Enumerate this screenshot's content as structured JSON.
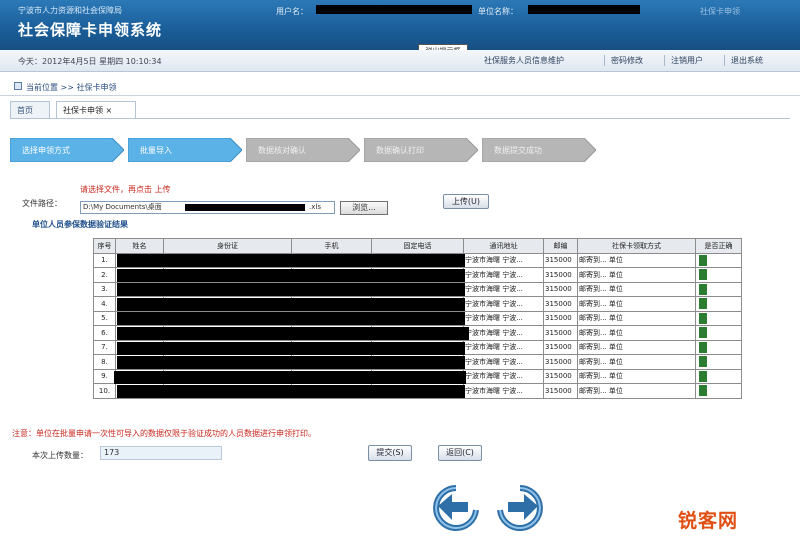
{
  "header": {
    "subtitle": "宁波市人力资源和社会保障局",
    "title": "社会保障卡申领系统",
    "user_label": "用户名：",
    "unit_label": "单位名称：",
    "right_text": "社保卡申领"
  },
  "infobar": {
    "date_text": "今天：2012年4月5日  星期四  10:10:34",
    "popup_tip": "弹出提示框",
    "nav": [
      "社保服务人员信息维护",
      "密码修改",
      "注销用户",
      "退出系统"
    ]
  },
  "location": {
    "prefix": "当前位置",
    "path": ">>  社保卡申领"
  },
  "tabs": [
    {
      "label": "首页"
    },
    {
      "label": "社保卡申领 ×"
    }
  ],
  "steps": [
    {
      "label": "选择申领方式",
      "active": true
    },
    {
      "label": "批量导入",
      "active": true
    },
    {
      "label": "数据核对确认",
      "active": false
    },
    {
      "label": "数据确认打印",
      "active": false
    },
    {
      "label": "数据提交成功",
      "active": false
    }
  ],
  "upload": {
    "label": "文件路径：",
    "tip": "请选择文件，再点击",
    "tip2": "上传",
    "file_value": "D:\\My Documents\\桌面",
    "file_tail": ".xls",
    "browse_label": "浏览...",
    "upload_btn": "上传(U)"
  },
  "section_title": "单位人员参保数据验证结果",
  "table": {
    "headers": [
      "序号",
      "姓名",
      "身份证",
      "手机",
      "固定电话",
      "通讯地址",
      "邮编",
      "社保卡领取方式",
      "是否正确"
    ],
    "rows": [
      {
        "no": "1.",
        "addr": "宁波市海曙",
        "addr2": "宁波...",
        "zip": "315000",
        "method": "邮寄到...",
        "method2": "单位"
      },
      {
        "no": "2.",
        "addr": "宁波市海曙",
        "addr2": "宁波...",
        "zip": "315000",
        "method": "邮寄到...",
        "method2": "单位"
      },
      {
        "no": "3.",
        "addr": "宁波市海曙",
        "addr2": "宁波...",
        "zip": "315000",
        "method": "邮寄到...",
        "method2": "单位"
      },
      {
        "no": "4.",
        "addr": "宁波市海曙",
        "addr2": "宁波...",
        "zip": "315000",
        "method": "邮寄到...",
        "method2": "单位"
      },
      {
        "no": "5.",
        "addr": "宁波市海曙",
        "addr2": "宁波...",
        "zip": "315000",
        "method": "邮寄到...",
        "method2": "单位"
      },
      {
        "no": "6.",
        "addr": "宁波市海曙",
        "addr2": "宁波...",
        "zip": "315000",
        "method": "邮寄到...",
        "method2": "单位"
      },
      {
        "no": "7.",
        "addr": "宁波市海曙",
        "addr2": "宁波...",
        "zip": "315000",
        "method": "邮寄到...",
        "method2": "单位"
      },
      {
        "no": "8.",
        "addr": "宁波市海曙",
        "addr2": "宁波...",
        "zip": "315000",
        "method": "邮寄到...",
        "method2": "单位"
      },
      {
        "no": "9.",
        "addr": "宁波市海曙",
        "addr2": "宁波...",
        "zip": "315000",
        "method": "邮寄到...",
        "method2": "单位"
      },
      {
        "no": "10.",
        "addr": "宁波市海曙",
        "addr2": "宁波...",
        "zip": "315000",
        "method": "邮寄到...",
        "method2": "单位"
      }
    ]
  },
  "notice": "注意：单位在批量申请一次性可导入的数据仅限于验证成功的人员数据进行申领打印。",
  "total": {
    "label": "本次上传数量：",
    "value": "173"
  },
  "actions": {
    "submit": "提交(S)",
    "cancel": "返回(C)"
  },
  "nav": {
    "prev_icon": "arrow-left-icon",
    "next_icon": "arrow-right-icon"
  },
  "watermark": "锐客网",
  "colors": {
    "header": "#1a5d98",
    "step_active": "#5ab2e6",
    "step_inactive": "#b6b6b6",
    "notice": "#c8281e",
    "valid": "#2c7d31"
  }
}
